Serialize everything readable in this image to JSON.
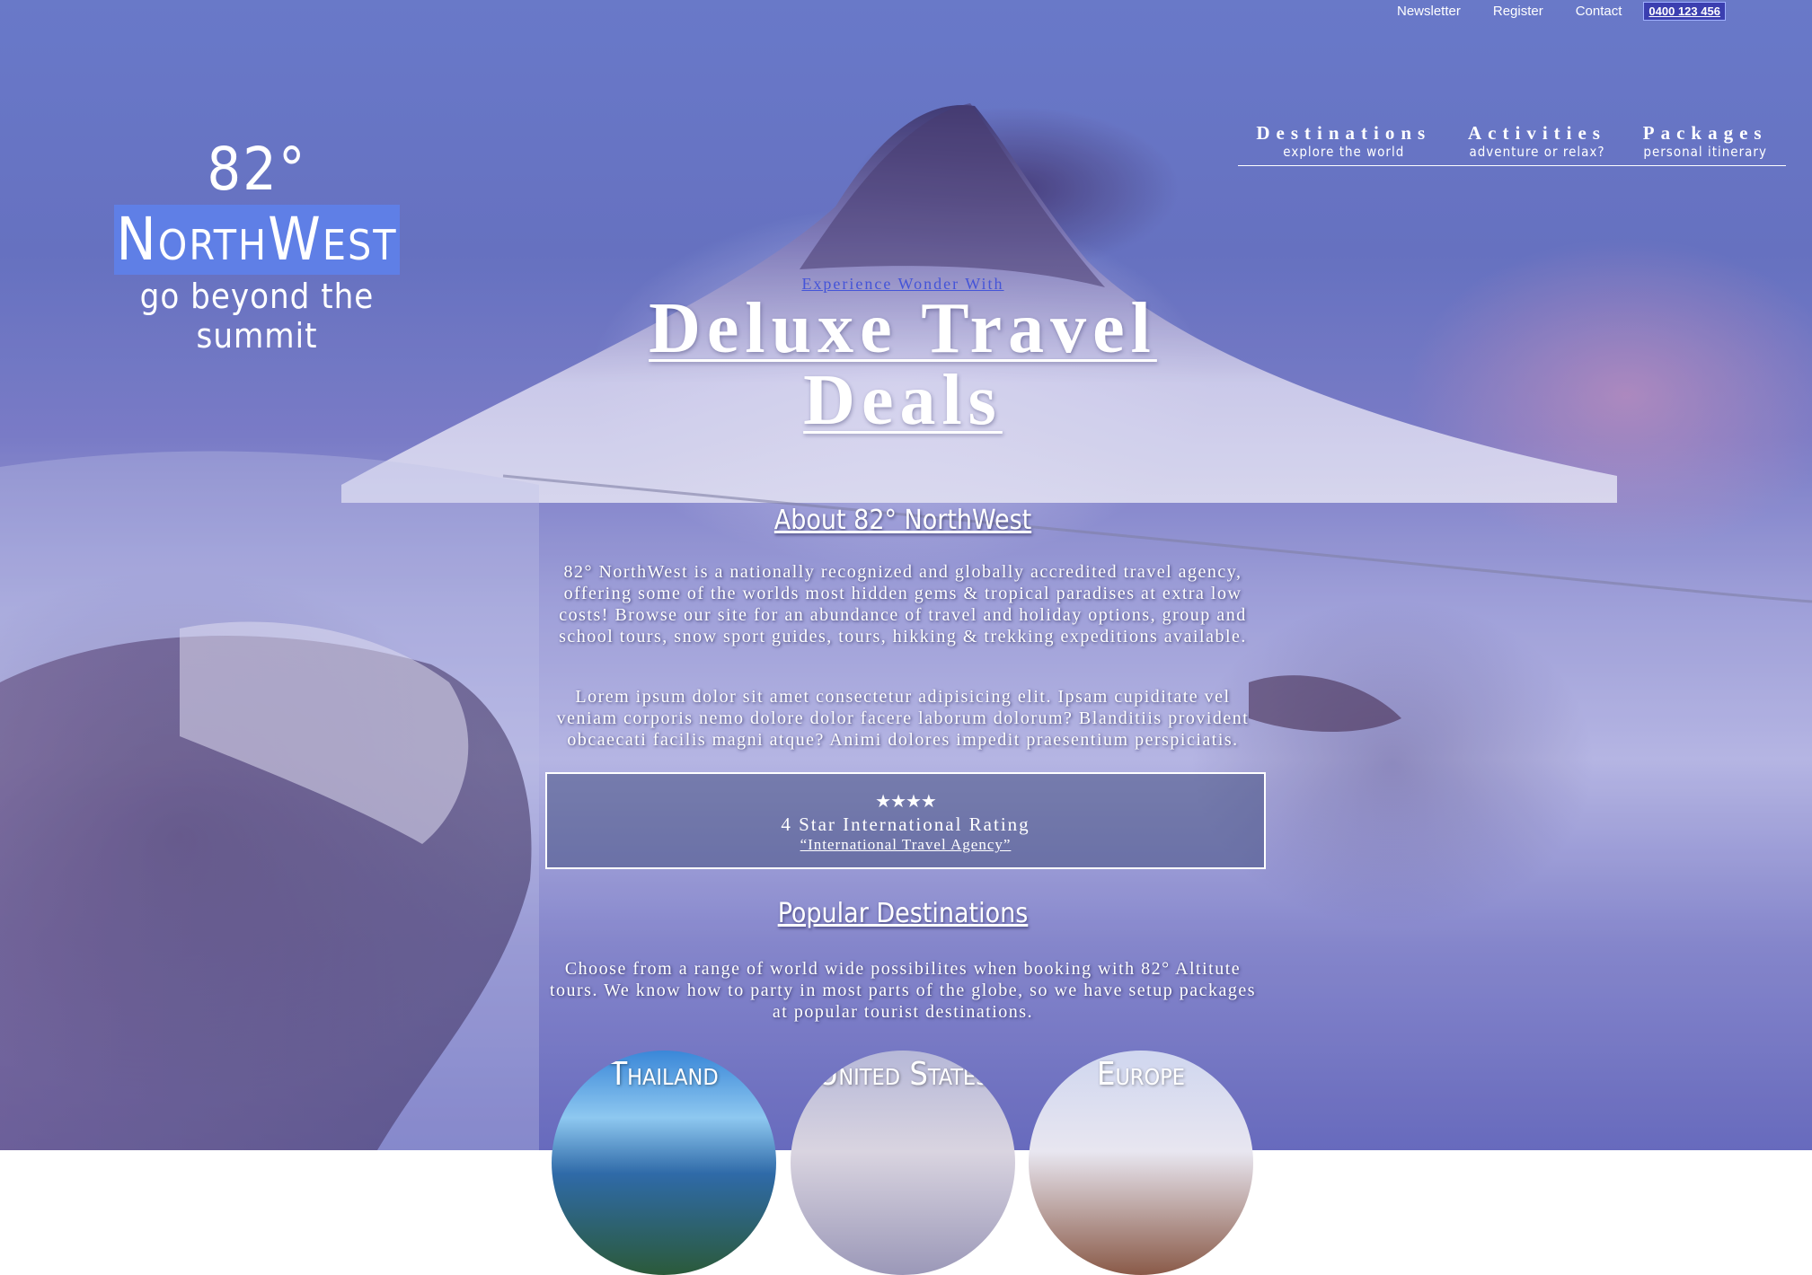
{
  "topbar": {
    "newsletter": "Newsletter",
    "register": "Register",
    "contact": "Contact",
    "phone": "0400 123 456"
  },
  "logo": {
    "degree": "82°",
    "name": "NorthWest",
    "tagline": "go beyond the summit"
  },
  "nav": [
    {
      "title": "Destinations",
      "subtitle": "explore the world"
    },
    {
      "title": "Activities",
      "subtitle": "adventure or relax?"
    },
    {
      "title": "Packages",
      "subtitle": "personal itinerary"
    }
  ],
  "hero": {
    "kicker": "Experience Wonder With",
    "title_line1": "Deluxe Travel",
    "title_line2": "Deals"
  },
  "about": {
    "heading": "About 82° NorthWest",
    "paragraph1": "82° NorthWest is a nationally recognized and globally accredited travel agency, offering some of the worlds most hidden gems & tropical paradises at extra low costs! Browse our site for an abundance of travel and holiday options, group and school tours, snow sport guides, tours, hikking & trekking expeditions available.",
    "paragraph2": "Lorem ipsum dolor sit amet consectetur adipisicing elit. Ipsam cupiditate vel veniam corporis nemo dolore dolor facere laborum dolorum? Blanditiis provident obcaecati facilis magni atque? Animi dolores impedit praesentium perspiciatis."
  },
  "rating": {
    "stars": "★★★★",
    "star_count": 4,
    "text": "4 Star International Rating",
    "link": "“International Travel Agency”"
  },
  "popular": {
    "heading": "Popular Destinations",
    "paragraph": "Choose from a range of world wide possibilites when booking with 82° Altitute tours. We know how to party in most parts of the globe, so we have setup packages at popular tourist destinations.",
    "destinations": [
      "Thailand",
      "United States",
      "Europe"
    ]
  },
  "colors": {
    "logo_highlight": "#5f7fe6",
    "phone_bg": "#3b3fb0",
    "kicker": "#4454d8"
  }
}
